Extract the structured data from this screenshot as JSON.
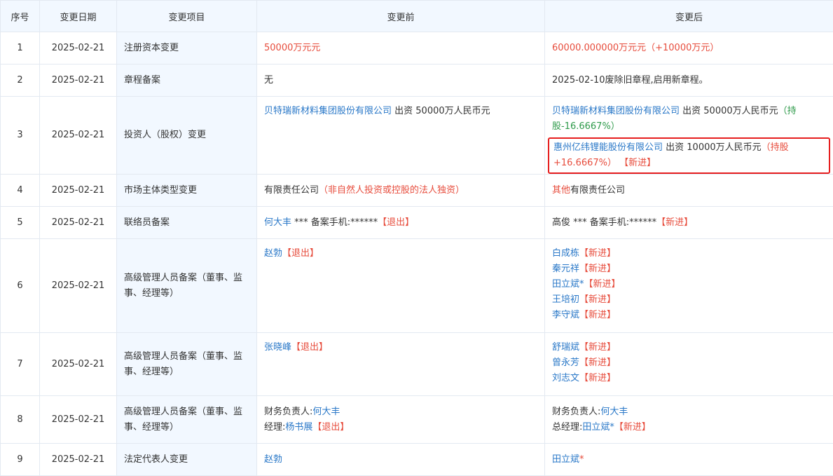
{
  "headers": {
    "seq": "序号",
    "date": "变更日期",
    "item": "变更项目",
    "before": "变更前",
    "after": "变更后"
  },
  "rows": [
    {
      "seq": "1",
      "date": "2025-02-21",
      "item": "注册资本变更"
    },
    {
      "seq": "2",
      "date": "2025-02-21",
      "item": "章程备案"
    },
    {
      "seq": "3",
      "date": "2025-02-21",
      "item": "投资人（股权）变更"
    },
    {
      "seq": "4",
      "date": "2025-02-21",
      "item": "市场主体类型变更"
    },
    {
      "seq": "5",
      "date": "2025-02-21",
      "item": "联络员备案"
    },
    {
      "seq": "6",
      "date": "2025-02-21",
      "item": "高级管理人员备案（董事、监事、经理等）"
    },
    {
      "seq": "7",
      "date": "2025-02-21",
      "item": "高级管理人员备案（董事、监事、经理等）"
    },
    {
      "seq": "8",
      "date": "2025-02-21",
      "item": "高级管理人员备案（董事、监事、经理等）"
    },
    {
      "seq": "9",
      "date": "2025-02-21",
      "item": "法定代表人变更"
    }
  ],
  "r1": {
    "before": "50000万元元",
    "after": "60000.000000万元元（+10000万元）"
  },
  "r2": {
    "before": "无",
    "after": "2025-02-10废除旧章程,启用新章程。"
  },
  "r3": {
    "before_company": "贝特瑞新材料集团股份有限公司",
    "before_text": " 出资 50000万人民币元",
    "after1_company": "贝特瑞新材料集团股份有限公司",
    "after1_text": " 出资 50000万人民币元",
    "after1_change": "（持股-16.6667%）",
    "after2_company": "惠州亿纬锂能股份有限公司",
    "after2_text": " 出资 10000万人民币元",
    "after2_change": "（持股+16.6667%）",
    "after2_tag": " 【新进】"
  },
  "r4": {
    "before_text": "有限责任公司",
    "before_note": "（非自然人投资或控股的法人独资）",
    "after_red": "其他",
    "after_text": "有限责任公司"
  },
  "r5": {
    "before_name": "何大丰",
    "before_text": " *** 备案手机:******",
    "before_tag": "【退出】",
    "after_text": "高俊 *** 备案手机:******",
    "after_tag": "【新进】"
  },
  "r6": {
    "before_name": "赵勃",
    "before_tag": "【退出】",
    "after": [
      {
        "name": "白成栋",
        "tag": "【新进】"
      },
      {
        "name": "秦元祥",
        "tag": "【新进】"
      },
      {
        "name": "田立斌*",
        "tag": "【新进】"
      },
      {
        "name": "王培初",
        "tag": "【新进】"
      },
      {
        "name": "李守斌",
        "tag": "【新进】"
      }
    ]
  },
  "r7": {
    "before_name": "张晓峰",
    "before_tag": "【退出】",
    "after": [
      {
        "name": "舒瑞斌",
        "tag": "【新进】"
      },
      {
        "name": "曾永芳",
        "tag": "【新进】"
      },
      {
        "name": "刘志文",
        "tag": "【新进】"
      }
    ]
  },
  "r8": {
    "before_l1_label": "财务负责人:",
    "before_l1_name": "何大丰",
    "before_l2_label": "经理:",
    "before_l2_name": "杨书展",
    "before_l2_tag": "【退出】",
    "after_l1_label": "财务负责人:",
    "after_l1_name": "何大丰",
    "after_l2_label": "总经理:",
    "after_l2_name": "田立斌*",
    "after_l2_tag": "【新进】"
  },
  "r9": {
    "before_name": "赵勃",
    "after_name": "田立斌",
    "after_star": "*"
  },
  "colors": {
    "link": "#2a78c8",
    "red": "#e74c3c",
    "green": "#2e9a4a",
    "header_bg": "#f2f8ff",
    "border": "#e3e9f1",
    "highlight": "#e61e1e"
  }
}
